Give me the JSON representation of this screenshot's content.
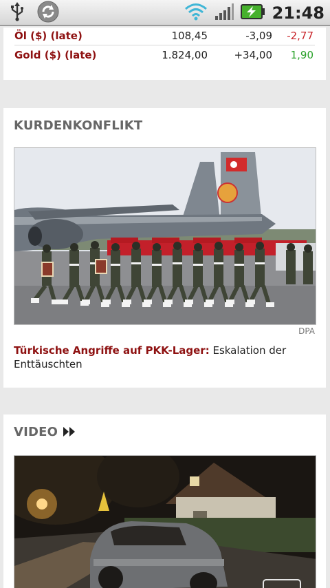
{
  "status_bar": {
    "time": "21:48",
    "icons": [
      "usb-icon",
      "sync-icon",
      "wifi-icon",
      "signal-icon",
      "battery-charging-icon"
    ]
  },
  "markets": {
    "rows": [
      {
        "name": "Öl ($) (late)",
        "value": "108,45",
        "change": "-3,09",
        "pct": "-2,77",
        "trend": "neg"
      },
      {
        "name": "Gold ($) (late)",
        "value": "1.824,00",
        "change": "+34,00",
        "pct": "1,90",
        "trend": "pos"
      }
    ]
  },
  "kurden": {
    "section_title": "KURDENKONFLIKT",
    "photo_credit": "DPA",
    "headline_kicker": "Türkische Angriffe auf PKK-Lager:",
    "headline_text": " Eskalation der Enttäuschten"
  },
  "video": {
    "section_title": "VIDEO",
    "arrow_icon": "fast-forward-icon"
  },
  "colors": {
    "accent_red": "#8e1111",
    "negative": "#c9242a",
    "positive": "#2aa12a"
  }
}
